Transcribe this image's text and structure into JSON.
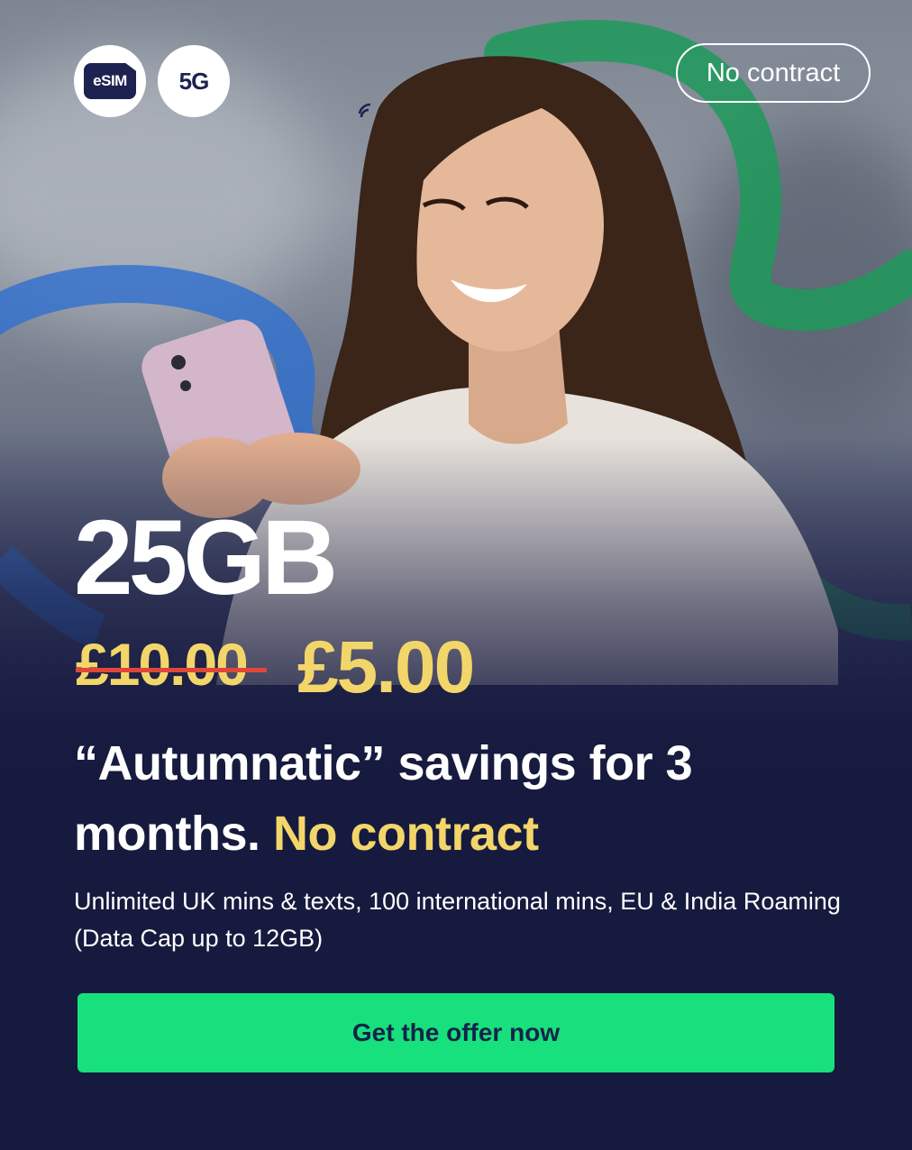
{
  "badges": {
    "esim_label": "eSIM",
    "fiveg_label": "5G"
  },
  "pill": {
    "label": "No contract"
  },
  "offer": {
    "data_amount": "25GB",
    "old_price": "£10.00",
    "new_price": "£5.00",
    "tagline_main": "“Autumnatic” savings for 3 months.",
    "tagline_highlight": "No contract",
    "description": "Unlimited UK mins & texts, 100 international mins, EU & India Roaming (Data Cap up to 12GB)"
  },
  "cta": {
    "label": "Get the offer now"
  },
  "colors": {
    "navy": "#161a3e",
    "yellow": "#f3d66a",
    "green": "#17e07c",
    "strike_red": "#e0463a",
    "ribbon_green": "#1f9a5a",
    "ribbon_blue": "#2f6fd0"
  }
}
